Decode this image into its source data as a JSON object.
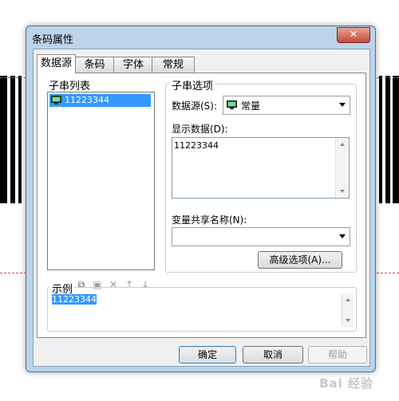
{
  "window": {
    "title": "条码属性",
    "close_label": "✕"
  },
  "tabs": [
    {
      "label": "数据源"
    },
    {
      "label": "条码"
    },
    {
      "label": "字体"
    },
    {
      "label": "常规"
    }
  ],
  "substring_list": {
    "label": "子串列表",
    "items": [
      {
        "label": "11223344",
        "icon": "monitor-icon",
        "selected": true
      }
    ],
    "toolbar_icons": [
      "new-icon",
      "copy-icon",
      "paste-icon",
      "delete-icon",
      "move-up-icon",
      "move-down-icon"
    ]
  },
  "substring_options": {
    "label": "子串选项",
    "datasource_label": "数据源(S):",
    "datasource_value": "常量",
    "display_data_label": "显示数据(D):",
    "display_data_value": "11223344",
    "shared_var_label": "变量共享名称(N):",
    "shared_var_value": "",
    "advanced_button": "高级选项(A)..."
  },
  "example": {
    "label": "示例",
    "value": "11223344"
  },
  "buttons": {
    "ok": "确定",
    "cancel": "取消",
    "help": "帮助"
  },
  "watermark": "Bai 经验",
  "colors": {
    "selection": "#3399ff",
    "close": "#c6483a",
    "frame": "#bcd3ea"
  }
}
